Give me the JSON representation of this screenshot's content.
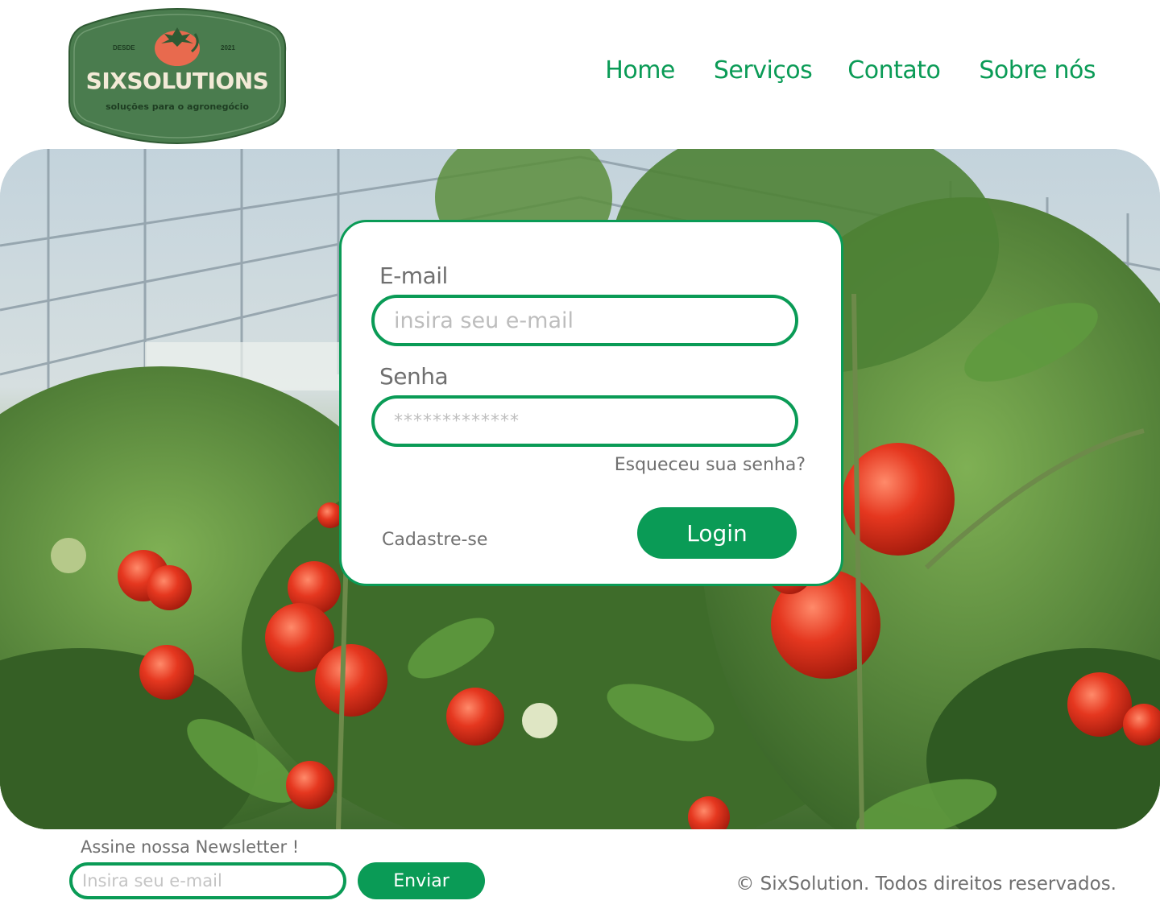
{
  "logo": {
    "brand": "SIXSOLUTIONS",
    "tagline": "soluções para o agronegócio",
    "since_label": "DESDE",
    "year": "2021",
    "badge_color": "#4a7c4e",
    "icon": "tomato-icon"
  },
  "nav": {
    "items": [
      {
        "label": "Home"
      },
      {
        "label": "Serviços"
      },
      {
        "label": "Contato"
      },
      {
        "label": "Sobre nós"
      }
    ]
  },
  "hero": {
    "image": "greenhouse-tomatoes-photo"
  },
  "login": {
    "email_label": "E-mail",
    "email_placeholder": "insira seu e-mail",
    "password_label": "Senha",
    "password_placeholder": "*************",
    "forgot_link": "Esqueceu sua senha?",
    "signup_link": "Cadastre-se",
    "login_button": "Login"
  },
  "footer": {
    "newsletter_label": "Assine nossa Newsletter !",
    "newsletter_placeholder": "Insira seu e-mail",
    "send_button": "Enviar",
    "copyright": "© SixSolution. Todos direitos reservados."
  },
  "colors": {
    "accent": "#0a9b56",
    "text_gray": "#6f6f6f",
    "placeholder_gray": "#bdbdbd"
  }
}
